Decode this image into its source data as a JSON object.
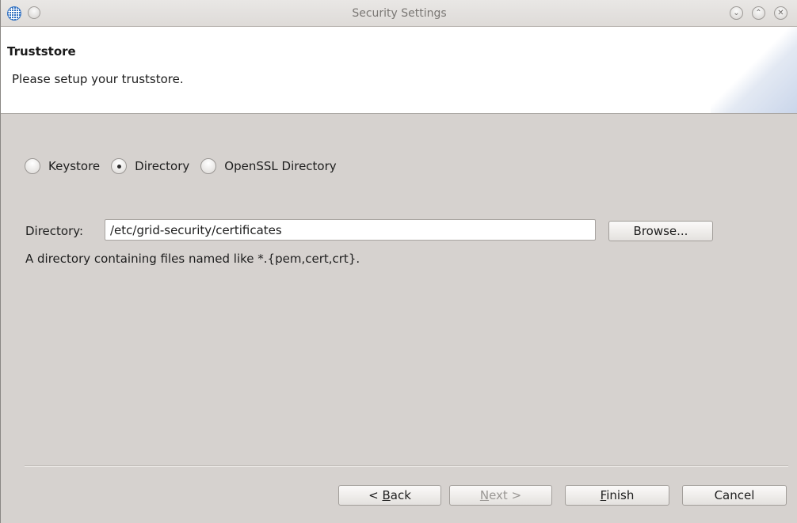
{
  "window": {
    "title": "Security Settings"
  },
  "banner": {
    "title": "Truststore",
    "subtitle": "Please setup your truststore."
  },
  "truststore_type": {
    "options": [
      {
        "label": "Keystore",
        "selected": false
      },
      {
        "label": "Directory",
        "selected": true
      },
      {
        "label": "OpenSSL Directory",
        "selected": false
      }
    ]
  },
  "directory": {
    "label": "Directory:",
    "value": "/etc/grid-security/certificates",
    "browse_label": "Browse...",
    "hint": "A directory containing files named like *.{pem,cert,crt}."
  },
  "footer": {
    "back": {
      "prefix": "< ",
      "mnemonic": "B",
      "rest": "ack"
    },
    "next": {
      "mnemonic": "N",
      "rest": "ext >",
      "enabled": false
    },
    "finish": {
      "mnemonic": "F",
      "rest": "inish"
    },
    "cancel_label": "Cancel"
  }
}
